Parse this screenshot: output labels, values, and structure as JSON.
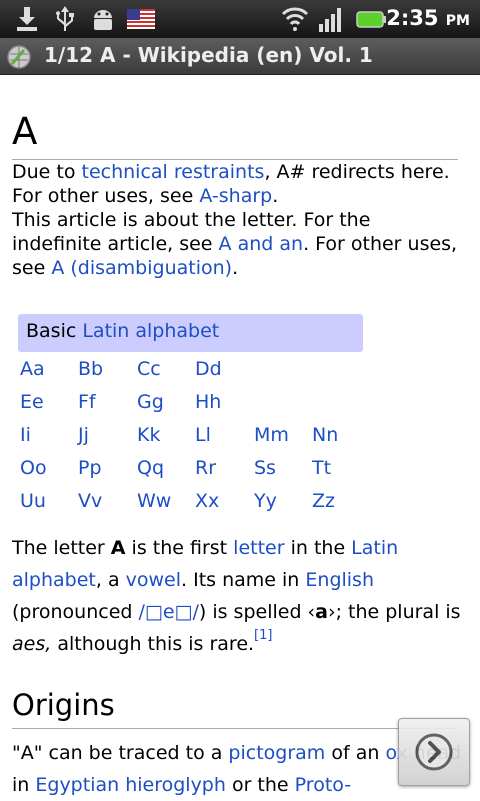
{
  "status": {
    "time": "2:35",
    "ampm": "PM",
    "icons": [
      "download-icon",
      "usb-icon",
      "android-debug-icon",
      "us-flag-icon",
      "wifi-icon",
      "signal-icon",
      "battery-icon"
    ]
  },
  "titlebar": {
    "title": "1/12 A - Wikipedia (en) Vol. 1"
  },
  "article": {
    "title": "A",
    "hatnote": {
      "p1a": "Due to ",
      "link_restraints": "technical restraints",
      "p1b": ", A# redirects here.",
      "p2a": "For other uses, see ",
      "link_asharp": "A-sharp",
      "p2b": ".",
      "p3a": "This article is about the letter. For the indefinite article, see ",
      "link_a_and_an": "A and an",
      "p3b": ". For other uses, see ",
      "link_disambig": "A (disambiguation)",
      "p3c": "."
    },
    "alphabet_box": {
      "prefix": "Basic ",
      "link": "Latin alphabet",
      "rows": [
        [
          "Aa",
          "Bb",
          "Cc",
          "Dd"
        ],
        [
          "Ee",
          "Ff",
          "Gg",
          "Hh"
        ],
        [
          "Ii",
          "Jj",
          "Kk",
          "Ll",
          "Mm",
          "Nn"
        ],
        [
          "Oo",
          "Pp",
          "Qq",
          "Rr",
          "Ss",
          "Tt"
        ],
        [
          "Uu",
          "Vv",
          "Ww",
          "Xx",
          "Yy",
          "Zz"
        ]
      ]
    },
    "intro": {
      "t1": "The letter ",
      "bold_a": "A",
      "t2": " is the first ",
      "link_letter": "letter",
      "t3": " in the ",
      "link_latin_alphabet": "Latin alphabet",
      "t4": ", a ",
      "link_vowel": "vowel",
      "t5": ". Its name in ",
      "link_english": "English",
      "t6": " (pronounced ",
      "link_ipa": "/□e□/",
      "t7": ") is spelled ‹",
      "bold_a2": "a",
      "t8": "›; the plural is ",
      "italic_aes": "aes,",
      "t9": " although this is rare.",
      "ref": "[1]"
    },
    "origins": {
      "heading": "Origins",
      "t1": "\"A\" can be traced to a ",
      "link_pictogram": "pictogram",
      "t2": " of an ",
      "link_ox": "ox",
      "t3": " head in ",
      "link_egyptian": "Egyptian hieroglyph",
      "t4": " or the ",
      "link_proto": "Proto-"
    }
  }
}
